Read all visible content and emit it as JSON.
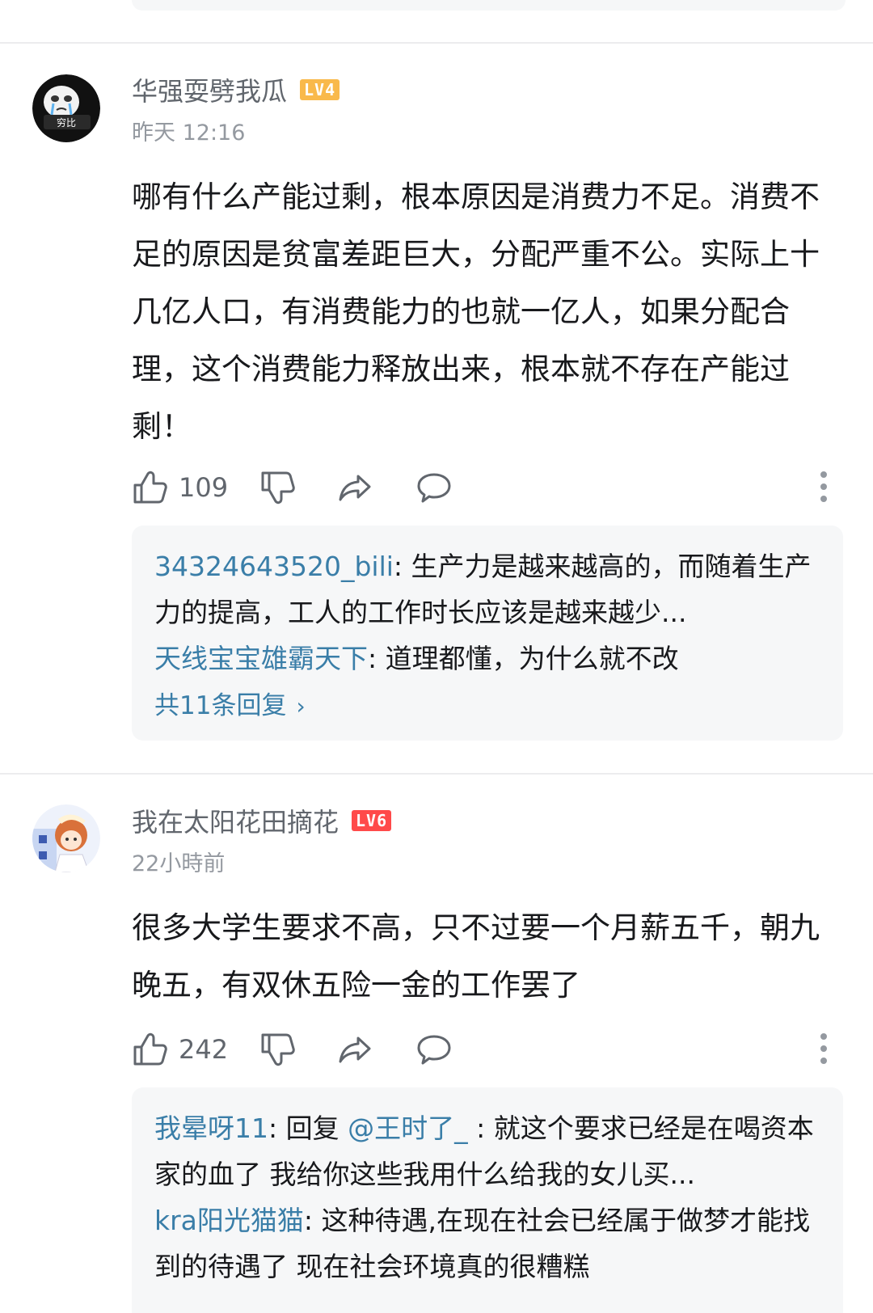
{
  "comments": [
    {
      "username": "华强耍劈我瓜",
      "level": "LV4",
      "level_color": "#f9b94b",
      "avatar_icon": "crying-meme-avatar",
      "avatar_text": "穷比",
      "time": "昨天 12:16",
      "content": "哪有什么产能过剩，根本原因是消费力不足。消费不足的原因是贫富差距巨大，分配严重不公。实际上十几亿人口，有消费能力的也就一亿人，如果分配合理，这个消费能力释放出来，根本就不存在产能过剩！",
      "likes": "109",
      "replies": [
        {
          "user": "34324643520_bili",
          "text": "生产力是越来越高的，而随着生产力的提高，工人的工作时长应该是越来越少..."
        },
        {
          "user": "天线宝宝雄霸天下",
          "text": "道理都懂，为什么就不改"
        }
      ],
      "total_replies": "共11条回复"
    },
    {
      "username": "我在太阳花田摘花",
      "level": "LV6",
      "level_color": "#ff4a4a",
      "avatar_icon": "anime-girl-avatar",
      "time": "22小時前",
      "content": "很多大学生要求不高，只不过要一个月薪五千，朝九晚五，有双休五险一金的工作罢了",
      "likes": "242",
      "replies": [
        {
          "user": "我晕呀11",
          "prefix": "回复 ",
          "mention": "@王时了_",
          "text": " 就这个要求已经是在喝资本家的血了 我给你这些我用什么给我的女儿买..."
        },
        {
          "user": "kra阳光猫猫",
          "text": "这种待遇,在现在社会已经属于做梦才能找到的待遇了 现在社会环境真的很糟糕"
        }
      ]
    }
  ],
  "icons": {
    "like": "thumbs-up-icon",
    "dislike": "thumbs-down-icon",
    "share": "share-icon",
    "reply": "comment-bubble-icon",
    "more": "more-vertical-icon"
  }
}
